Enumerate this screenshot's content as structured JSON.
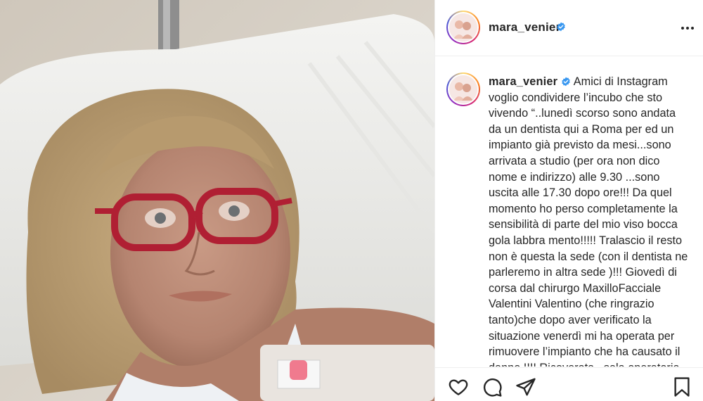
{
  "post": {
    "username": "mara_venier",
    "verified": true,
    "caption_lines": [
      "voglio condividere l’incubo che sto",
      "vivendo “..lunedì scorso sono andata",
      "da un dentista qui a Roma per ed un",
      "impianto già previsto da mesi...sono",
      "arrivata a studio (per ora non dico",
      "nome e indirizzo) alle 9.30 ...sono",
      "uscita alle 17.30 dopo ore!!! Da quel",
      "momento ho perso completamente la",
      "sensibilità di parte del mio viso bocca",
      "gola labbra mento!!!!! Tralascio il resto",
      "non è questa la sede (con il dentista ne",
      "parleremo in altra sede )!!! Giovedì di",
      "corsa dal chirurgo MaxilloFacciale",
      "Valentini Valentino (che ringrazio",
      "tanto)che dopo aver verificato la",
      "situazione venerdì mi ha operata per",
      "rimuovere l’impianto che ha causato il",
      "danno !!!! Ricoverata...sala operatoria"
    ],
    "caption_first_line": "Amici di Instagram"
  },
  "icons": {
    "verified": "verified-badge-icon",
    "more": "more-options-icon",
    "like": "heart-icon",
    "comment": "comment-icon",
    "share": "paper-plane-icon",
    "save": "bookmark-icon"
  },
  "colors": {
    "text": "#262626",
    "verified": "#3897f0",
    "divider": "#efefef"
  }
}
